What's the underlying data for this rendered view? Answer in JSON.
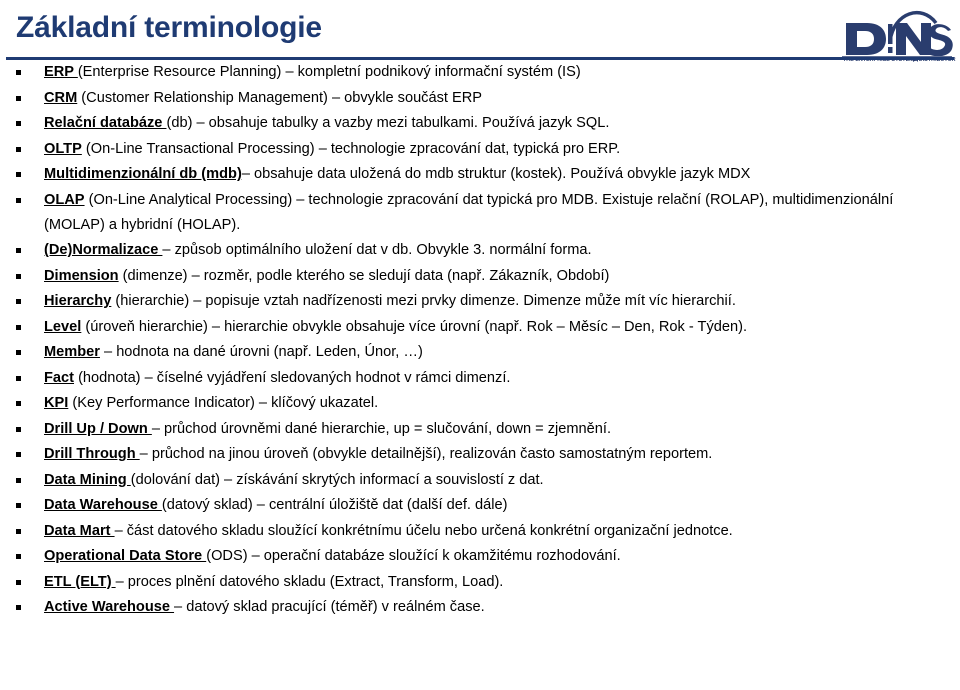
{
  "slide": {
    "title": "Základní terminologie",
    "accent_color": "#1F3B73",
    "text_color": "#000000",
    "background_color": "#FFFFFF"
  },
  "logo": {
    "name": "dns-logo",
    "wordmark": "DNS",
    "tagline": "THE ENTERPRISE SYSTEMS DISTRIBUTOR",
    "color": "#2A3D6E"
  },
  "bullets": [
    {
      "term": "ERP ",
      "rest": "(Enterprise Resource Planning) – kompletní podnikový informační systém (IS)"
    },
    {
      "term": "CRM",
      "rest": " (Customer Relationship Management) – obvykle součást ERP"
    },
    {
      "term": "Relační databáze ",
      "rest": "(db) – obsahuje tabulky a vazby mezi tabulkami. Používá jazyk SQL."
    },
    {
      "term": "OLTP",
      "rest": " (On-Line Transactional Processing) – technologie zpracování dat, typická pro ERP."
    },
    {
      "term": "Multidimenzionální db  (mdb)",
      "rest": "– obsahuje data uložená do mdb struktur (kostek). Používá obvykle jazyk MDX"
    },
    {
      "term": "OLAP",
      "rest": " (On-Line Analytical Processing) – technologie zpracování dat typická pro MDB. Existuje relační (ROLAP), multidimenzionální (MOLAP) a hybridní (HOLAP)."
    },
    {
      "term": "(De)Normalizace ",
      "rest": "– způsob optimálního uložení dat v db. Obvykle 3. normální forma."
    },
    {
      "term": "Dimension",
      "rest": " (dimenze) –  rozměr, podle kterého se sledují data (např. Zákazník, Období)"
    },
    {
      "term": "Hierarchy",
      "rest": " (hierarchie) – popisuje vztah nadřízenosti mezi prvky dimenze. Dimenze může mít víc hierarchií."
    },
    {
      "term": "Level",
      "rest": " (úroveň hierarchie) –  hierarchie obvykle obsahuje více úrovní (např. Rok – Měsíc – Den, Rok - Týden)."
    },
    {
      "term": "Member",
      "rest": " – hodnota na dané úrovni (např. Leden, Únor, …)"
    },
    {
      "term": "Fact",
      "rest": " (hodnota) –  číselné vyjádření sledovaných hodnot v rámci dimenzí."
    },
    {
      "term": "KPI",
      "rest": " (Key Performance Indicator) – klíčový ukazatel."
    },
    {
      "term": "Drill Up / Down ",
      "rest": "– průchod úrovněmi dané hierarchie, up = slučování, down = zjemnění."
    },
    {
      "term": "Drill Through ",
      "rest": "– průchod na jinou úroveň (obvykle detailnější), realizován často samostatným reportem."
    },
    {
      "term": "Data Mining ",
      "rest": "(dolování dat) – získávání skrytých informací a souvislostí z dat."
    },
    {
      "term": "Data Warehouse ",
      "rest": "(datový sklad) – centrální úložiště dat (další def. dále)"
    },
    {
      "term": "Data Mart ",
      "rest": " – část datového skladu sloužící konkrétnímu účelu nebo určená konkrétní organizační jednotce."
    },
    {
      "term": "Operational Data Store ",
      "rest": "(ODS) – operační  databáze sloužící k okamžitému rozhodování."
    },
    {
      "term": "ETL (ELT) ",
      "rest": "– proces plnění datového skladu (Extract, Transform, Load)."
    },
    {
      "term": "Active Warehouse ",
      "rest": "– datový sklad pracující (téměř) v reálném čase."
    }
  ]
}
